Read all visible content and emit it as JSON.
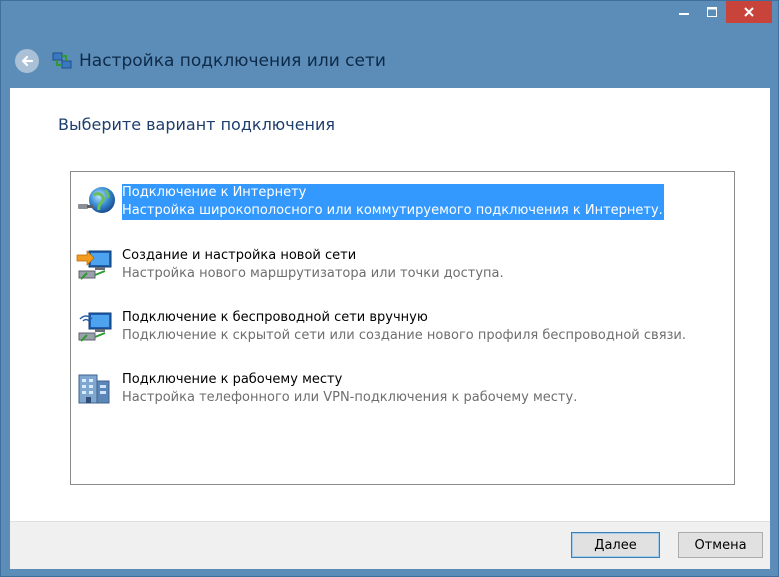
{
  "window": {
    "title": "Настройка подключения или сети",
    "frame_color": "#5c8db8",
    "close_color": "#c8443a"
  },
  "caption_buttons": {
    "minimize_icon": "minimize-icon",
    "maximize_icon": "maximize-icon",
    "close_icon": "close-icon"
  },
  "heading": "Выберите вариант подключения",
  "options": [
    {
      "title": "Подключение к Интернету",
      "description": "Настройка широкополосного или коммутируемого подключения к Интернету.",
      "icon": "globe-connection-icon",
      "selected": true
    },
    {
      "title": "Создание и настройка новой сети",
      "description": "Настройка нового маршрутизатора или точки доступа.",
      "icon": "new-network-icon",
      "selected": false
    },
    {
      "title": "Подключение к беспроводной сети вручную",
      "description": "Подключение к скрытой сети или создание нового профиля беспроводной связи.",
      "icon": "wireless-network-icon",
      "selected": false
    },
    {
      "title": "Подключение к рабочему месту",
      "description": "Настройка телефонного или VPN-подключения к рабочему месту.",
      "icon": "workplace-building-icon",
      "selected": false
    }
  ],
  "buttons": {
    "next": "Далее",
    "cancel": "Отмена"
  },
  "selection_color": "#3399ff"
}
